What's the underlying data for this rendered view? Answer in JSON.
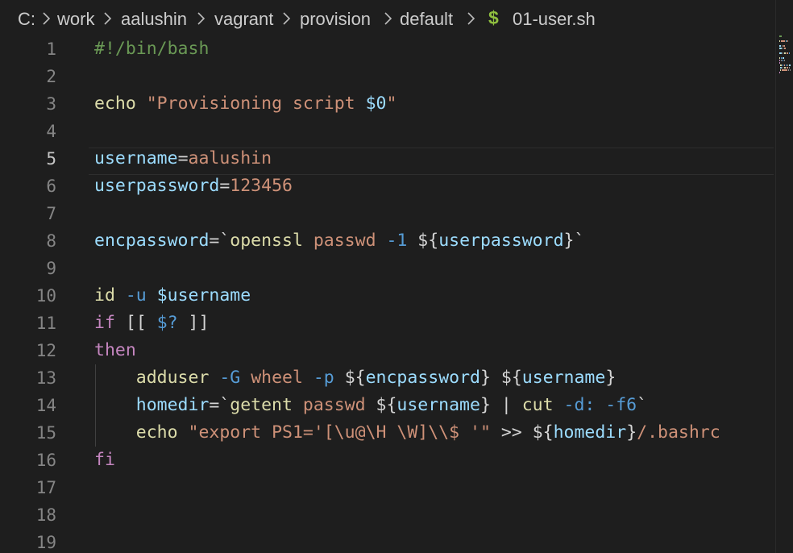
{
  "breadcrumb": {
    "items": [
      "C:",
      "work",
      "aalushin",
      "vagrant",
      "provision",
      "default"
    ],
    "file_icon": "$",
    "file_name": "01-user.sh"
  },
  "editor": {
    "active_line": 5,
    "line_numbers": [
      "1",
      "2",
      "3",
      "4",
      "5",
      "6",
      "7",
      "8",
      "9",
      "10",
      "11",
      "12",
      "13",
      "14",
      "15",
      "16",
      "17",
      "18",
      "19"
    ],
    "lines": [
      [
        {
          "t": "#!/bin/bash",
          "c": "cm"
        }
      ],
      [],
      [
        {
          "t": "echo ",
          "c": "fn"
        },
        {
          "t": "\"Provisioning script ",
          "c": "str"
        },
        {
          "t": "$0",
          "c": "var"
        },
        {
          "t": "\"",
          "c": "str"
        }
      ],
      [],
      [
        {
          "t": "username",
          "c": "var"
        },
        {
          "t": "=",
          "c": "op"
        },
        {
          "t": "aalushin",
          "c": "str"
        }
      ],
      [
        {
          "t": "userpassword",
          "c": "var"
        },
        {
          "t": "=",
          "c": "op"
        },
        {
          "t": "123456",
          "c": "str"
        }
      ],
      [],
      [
        {
          "t": "encpassword",
          "c": "var"
        },
        {
          "t": "=`",
          "c": "op"
        },
        {
          "t": "openssl ",
          "c": "fn"
        },
        {
          "t": "passwd ",
          "c": "str"
        },
        {
          "t": "-1 ",
          "c": "flag"
        },
        {
          "t": "${",
          "c": "dol"
        },
        {
          "t": "userpassword",
          "c": "var"
        },
        {
          "t": "}`",
          "c": "dol"
        }
      ],
      [],
      [
        {
          "t": "id ",
          "c": "fn"
        },
        {
          "t": "-u ",
          "c": "flag"
        },
        {
          "t": "$username",
          "c": "var"
        }
      ],
      [
        {
          "t": "if ",
          "c": "kw"
        },
        {
          "t": "[[ ",
          "c": "op"
        },
        {
          "t": "$? ",
          "c": "flag"
        },
        {
          "t": "]]",
          "c": "op"
        }
      ],
      [
        {
          "t": "then",
          "c": "kw"
        }
      ],
      [
        {
          "t": "    ",
          "c": "op"
        },
        {
          "t": "adduser ",
          "c": "fn"
        },
        {
          "t": "-G ",
          "c": "flag"
        },
        {
          "t": "wheel ",
          "c": "str"
        },
        {
          "t": "-p ",
          "c": "flag"
        },
        {
          "t": "${",
          "c": "dol"
        },
        {
          "t": "encpassword",
          "c": "var"
        },
        {
          "t": "} ",
          "c": "dol"
        },
        {
          "t": "${",
          "c": "dol"
        },
        {
          "t": "username",
          "c": "var"
        },
        {
          "t": "}",
          "c": "dol"
        }
      ],
      [
        {
          "t": "    ",
          "c": "op"
        },
        {
          "t": "homedir",
          "c": "var"
        },
        {
          "t": "=`",
          "c": "op"
        },
        {
          "t": "getent ",
          "c": "fn"
        },
        {
          "t": "passwd ",
          "c": "str"
        },
        {
          "t": "${",
          "c": "dol"
        },
        {
          "t": "username",
          "c": "var"
        },
        {
          "t": "} ",
          "c": "dol"
        },
        {
          "t": "| ",
          "c": "op"
        },
        {
          "t": "cut ",
          "c": "fn"
        },
        {
          "t": "-d: -f6",
          "c": "flag"
        },
        {
          "t": "`",
          "c": "op"
        }
      ],
      [
        {
          "t": "    ",
          "c": "op"
        },
        {
          "t": "echo ",
          "c": "fn"
        },
        {
          "t": "\"export PS1='[\\u@\\H \\W]\\\\$ '\" ",
          "c": "str"
        },
        {
          "t": ">> ",
          "c": "op"
        },
        {
          "t": "${",
          "c": "dol"
        },
        {
          "t": "homedir",
          "c": "var"
        },
        {
          "t": "}",
          "c": "dol"
        },
        {
          "t": "/.bashrc",
          "c": "str"
        }
      ],
      [
        {
          "t": "fi",
          "c": "kw"
        }
      ],
      [],
      [],
      []
    ]
  },
  "colors": {
    "background": "#1e1e1e",
    "comment": "#6a9955",
    "string": "#ce9178",
    "variable": "#9cdcfe",
    "function": "#dcdcaa",
    "keyword": "#c586c0",
    "flag": "#569cd6",
    "shell_icon": "#8fbf3f"
  }
}
